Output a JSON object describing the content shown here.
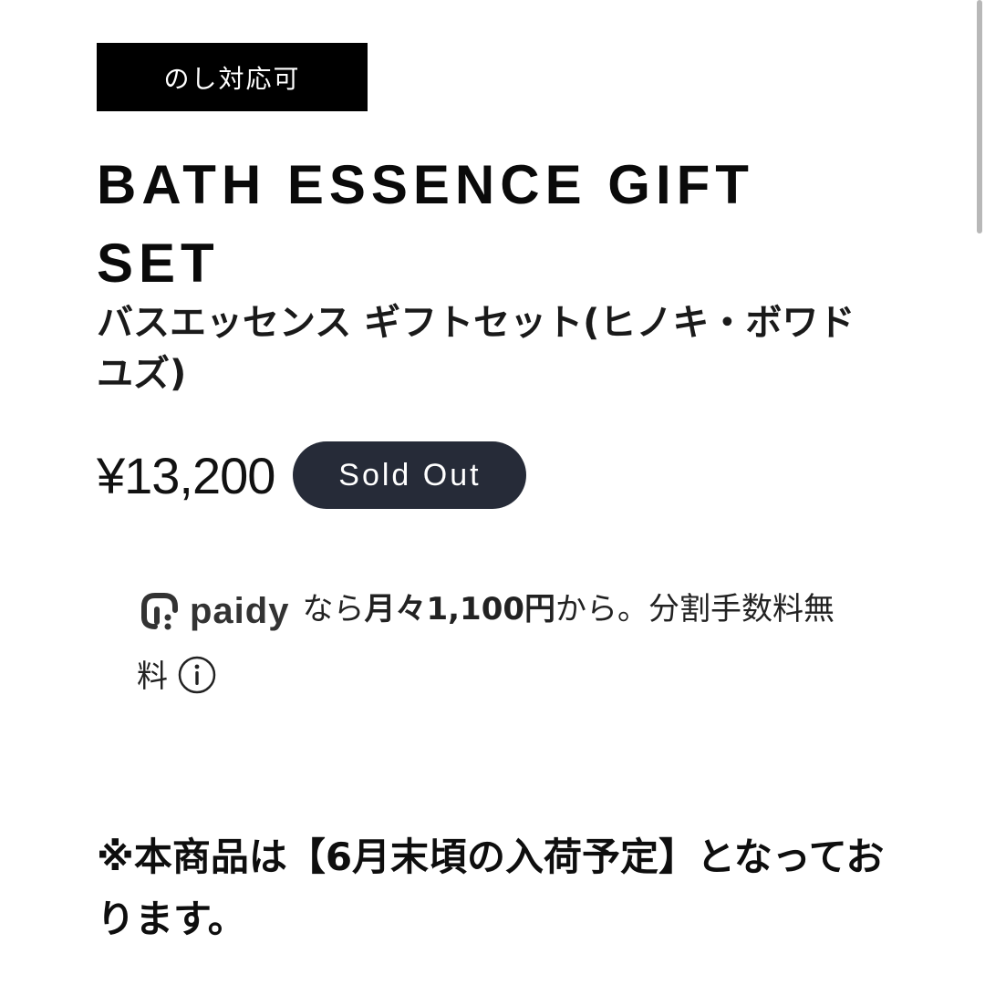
{
  "badge": {
    "label": "のし対応可"
  },
  "product": {
    "title_en": "BATH ESSENCE GIFT SET",
    "title_ja": "バスエッセンス ギフトセット(ヒノキ・ボワドユズ)",
    "price": "¥13,200",
    "status": "Sold Out"
  },
  "paidy": {
    "brand": "paidy",
    "icon": "paidy-logo-icon",
    "text_prefix": "なら",
    "monthly_amount": "月々1,100円",
    "text_suffix": "から。分割手数料無料",
    "info_icon": "info-icon"
  },
  "notice": {
    "text": "※本商品は【6月末頃の入荷予定】となっております。"
  },
  "colors": {
    "badge_bg": "#000000",
    "sold_out_bg": "#262b38",
    "text": "#111111"
  }
}
